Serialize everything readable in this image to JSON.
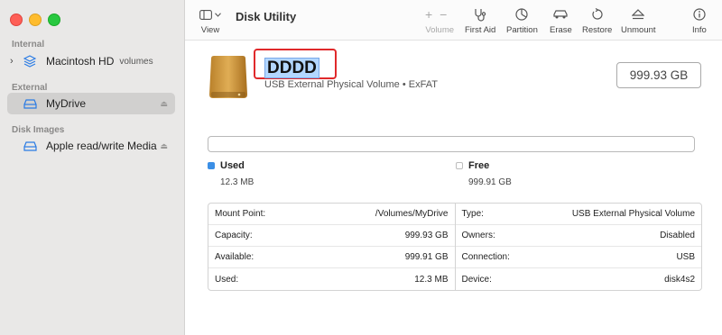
{
  "colors": {
    "used": "#3b8fe6",
    "free": "#ffffff",
    "highlight": "#e0292b",
    "selected_row": "#d1d0cf"
  },
  "window": {
    "title": "Disk Utility"
  },
  "sidebar": {
    "sections": [
      {
        "label": "Internal",
        "items": [
          {
            "label": "Macintosh HD",
            "sub": "volumes",
            "icon": "layers-icon"
          }
        ]
      },
      {
        "label": "External",
        "items": [
          {
            "label": "MyDrive",
            "icon": "drive-icon",
            "selected": true
          }
        ]
      },
      {
        "label": "Disk Images",
        "items": [
          {
            "label": "Apple read/write Media",
            "icon": "drive-icon"
          }
        ]
      }
    ]
  },
  "toolbar": {
    "view_label": "View",
    "buttons": [
      {
        "label": "Volume",
        "icon": "plus-minus-icon",
        "enabled": false
      },
      {
        "label": "First Aid",
        "icon": "stethoscope-icon",
        "enabled": true
      },
      {
        "label": "Partition",
        "icon": "pie-icon",
        "enabled": true
      },
      {
        "label": "Erase",
        "icon": "car-icon",
        "enabled": true
      },
      {
        "label": "Restore",
        "icon": "restore-icon",
        "enabled": true
      },
      {
        "label": "Unmount",
        "icon": "eject-icon",
        "enabled": true
      },
      {
        "label": "Info",
        "icon": "info-icon",
        "enabled": true
      }
    ]
  },
  "volume": {
    "name": "DDDD",
    "description": "USB External Physical Volume • ExFAT",
    "size": "999.93 GB"
  },
  "usage": {
    "used_fraction": 1.23e-05,
    "used_label": "Used",
    "used_value": "12.3 MB",
    "free_label": "Free",
    "free_value": "999.91 GB"
  },
  "info": {
    "left": [
      {
        "key": "Mount Point:",
        "value": "/Volumes/MyDrive"
      },
      {
        "key": "Capacity:",
        "value": "999.93 GB"
      },
      {
        "key": "Available:",
        "value": "999.91 GB"
      },
      {
        "key": "Used:",
        "value": "12.3 MB"
      }
    ],
    "right": [
      {
        "key": "Type:",
        "value": "USB External Physical Volume"
      },
      {
        "key": "Owners:",
        "value": "Disabled"
      },
      {
        "key": "Connection:",
        "value": "USB"
      },
      {
        "key": "Device:",
        "value": "disk4s2"
      }
    ]
  }
}
